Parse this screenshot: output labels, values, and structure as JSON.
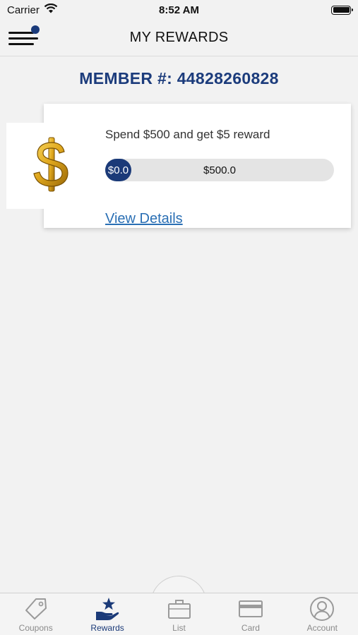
{
  "status_bar": {
    "carrier": "Carrier",
    "time": "8:52 AM"
  },
  "header": {
    "title": "MY REWARDS"
  },
  "member": {
    "label": "MEMBER #: 44828260828"
  },
  "reward": {
    "icon": "dollar-sign-icon",
    "description": "Spend $500 and get $5 reward",
    "progress_current": "$0.0",
    "progress_target": "$500.0",
    "progress_fraction": 0.0,
    "details_link": "View Details"
  },
  "tabs": [
    {
      "label": "Coupons",
      "icon": "tag-icon",
      "active": false
    },
    {
      "label": "Rewards",
      "icon": "star-hand-icon",
      "active": true
    },
    {
      "label": "List",
      "icon": "briefcase-icon",
      "active": false
    },
    {
      "label": "Card",
      "icon": "card-icon",
      "active": false
    },
    {
      "label": "Account",
      "icon": "user-icon",
      "active": false
    }
  ],
  "colors": {
    "brand": "#1b3a78",
    "link": "#2a6fb4",
    "inactive": "#8a8a8a",
    "gold": "#d4a017"
  }
}
